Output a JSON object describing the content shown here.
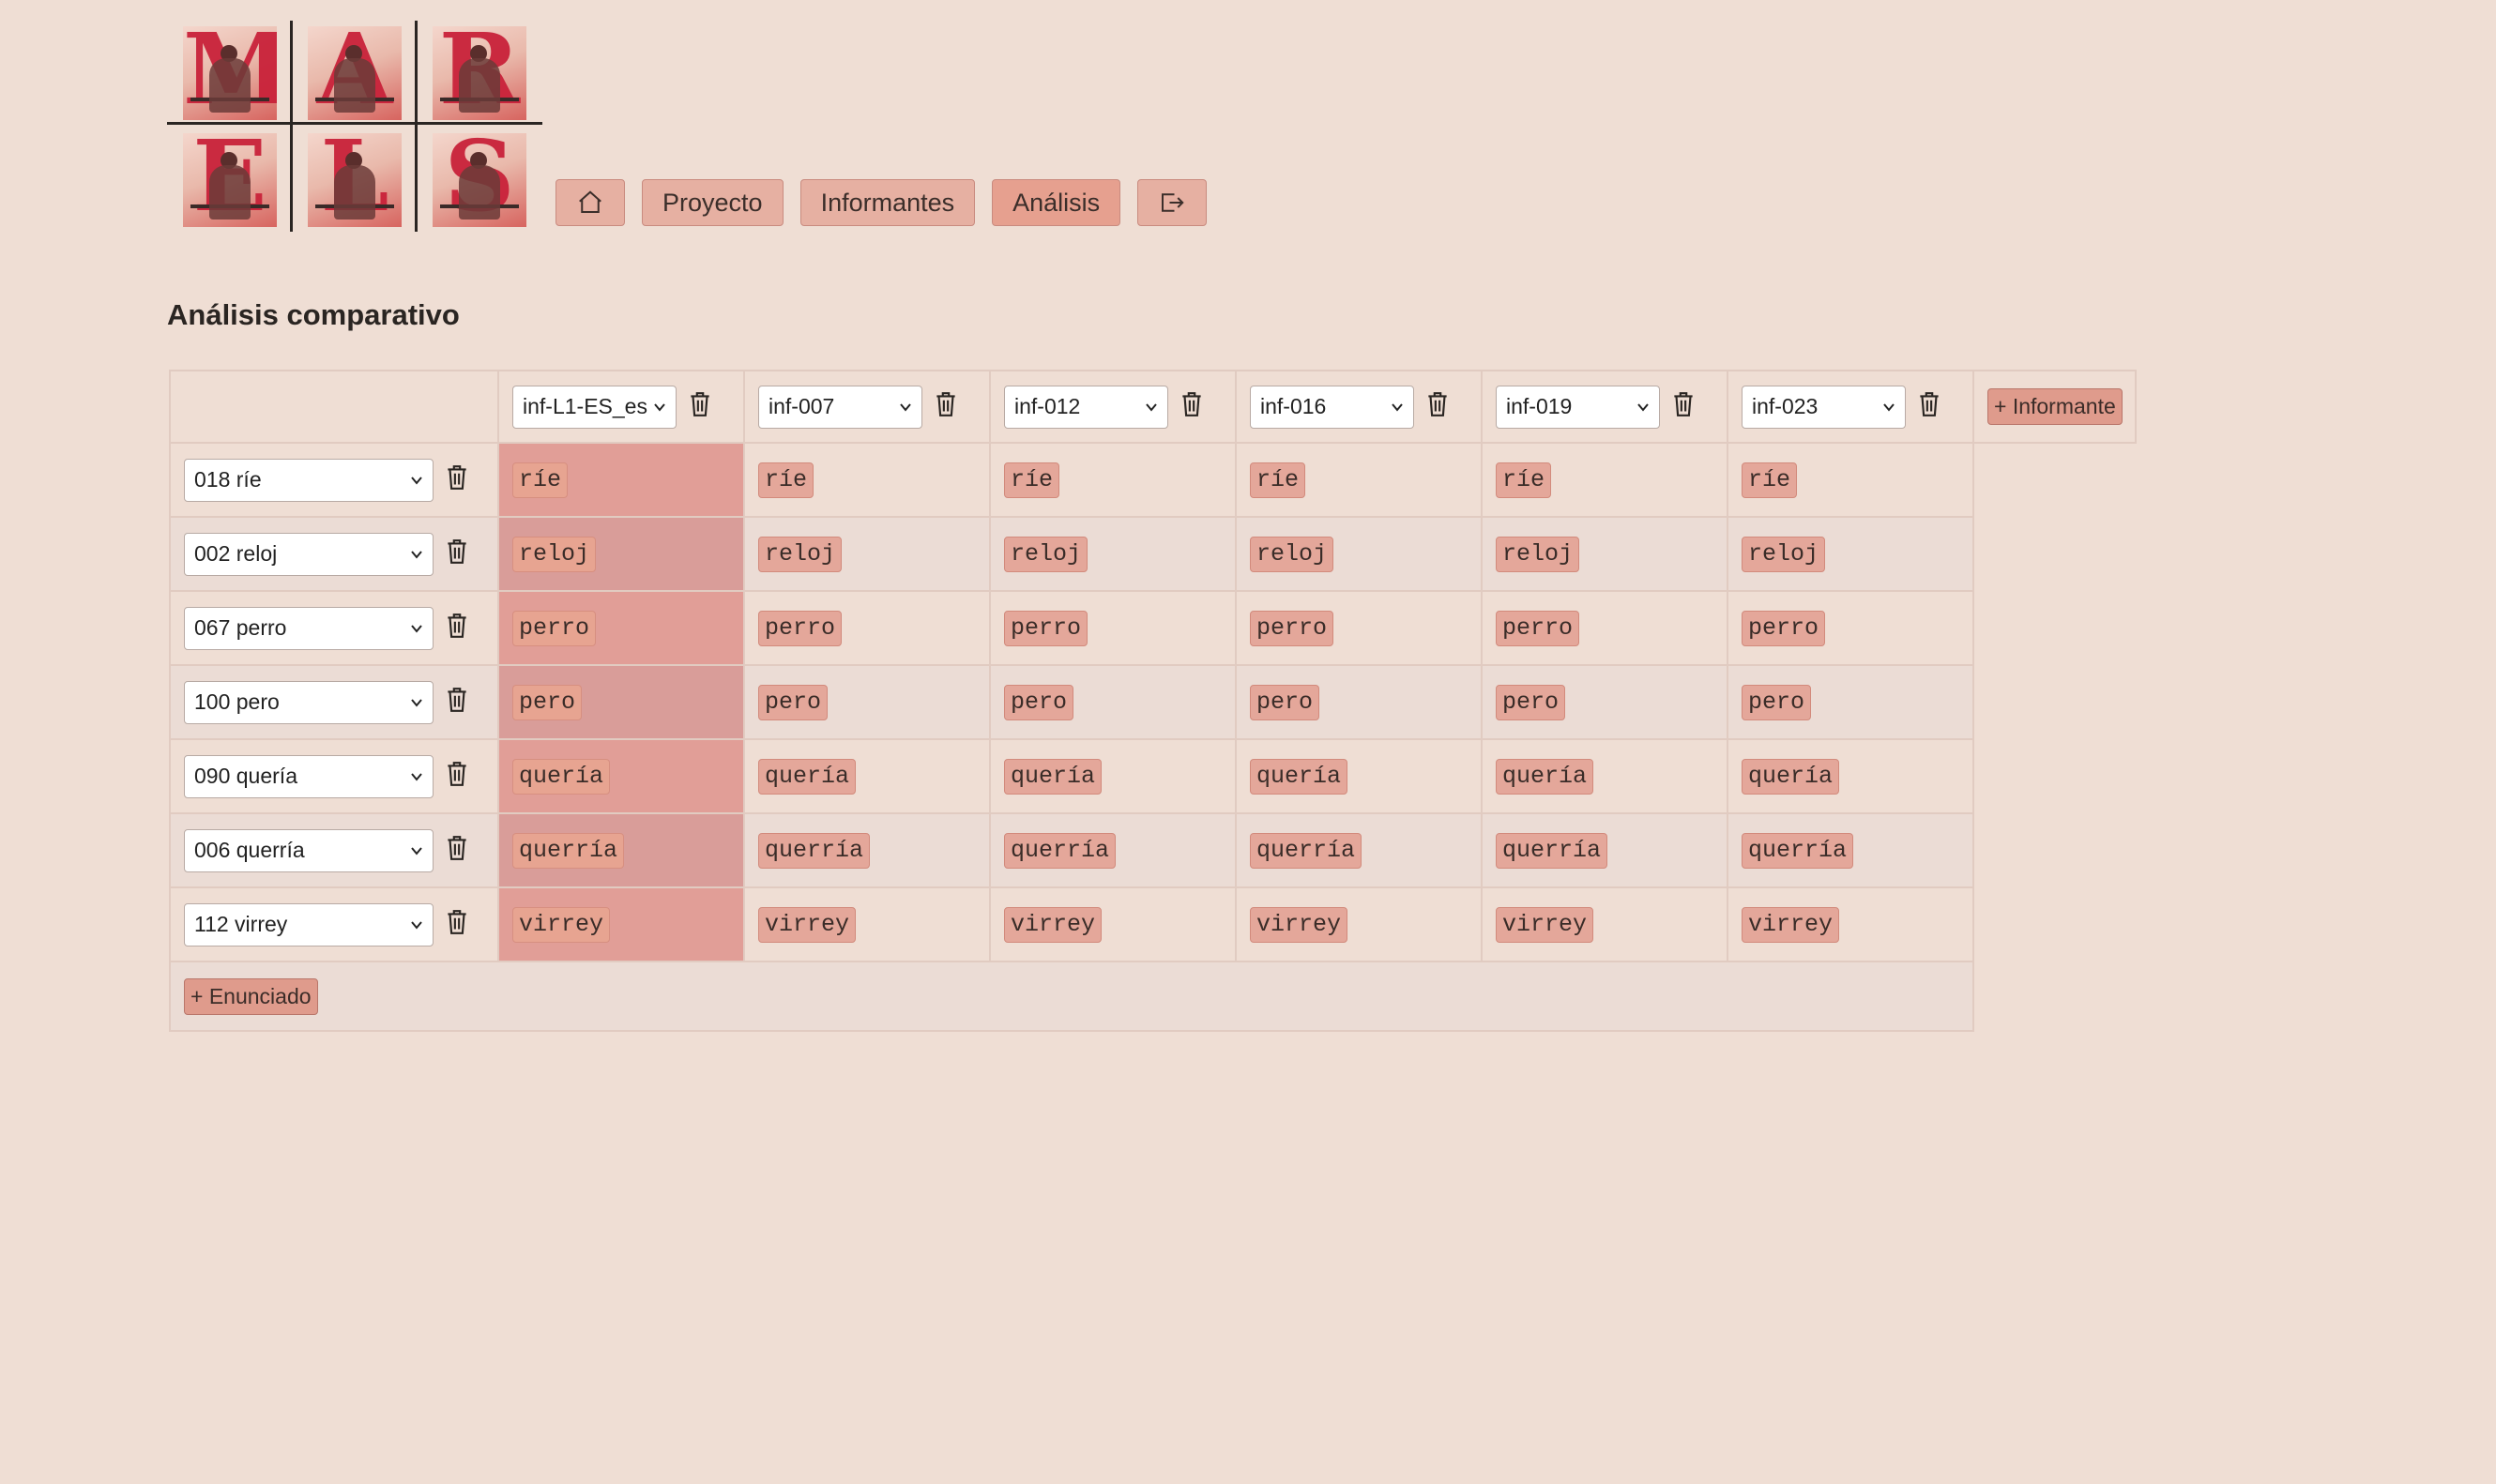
{
  "logo": {
    "letters": [
      "M",
      "A",
      "R",
      "E",
      "L",
      "S"
    ]
  },
  "nav": {
    "home_icon": "home-icon",
    "items": [
      "Proyecto",
      "Informantes",
      "Análisis"
    ],
    "active": "Análisis",
    "logout_icon": "logout-icon"
  },
  "title": "Análisis comparativo",
  "informants": [
    "inf-L1-ES_es",
    "inf-007",
    "inf-012",
    "inf-016",
    "inf-019",
    "inf-023"
  ],
  "add_informant_label": "+ Informante",
  "utterances": [
    {
      "label": "018 ríe",
      "values": [
        "ríe",
        "ríe",
        "ríe",
        "ríe",
        "ríe",
        "ríe"
      ]
    },
    {
      "label": "002 reloj",
      "values": [
        "reloj",
        "reloj",
        "reloj",
        "reloj",
        "reloj",
        "reloj"
      ]
    },
    {
      "label": "067 perro",
      "values": [
        "perro",
        "perro",
        "perro",
        "perro",
        "perro",
        "perro"
      ]
    },
    {
      "label": "100 pero",
      "values": [
        "pero",
        "pero",
        "pero",
        "pero",
        "pero",
        "pero"
      ]
    },
    {
      "label": "090 quería",
      "values": [
        "quería",
        "quería",
        "quería",
        "quería",
        "quería",
        "quería"
      ]
    },
    {
      "label": "006 querría",
      "values": [
        "querría",
        "querría",
        "querría",
        "querría",
        "querría",
        "querría"
      ]
    },
    {
      "label": "112 virrey",
      "values": [
        "virrey",
        "virrey",
        "virrey",
        "virrey",
        "virrey",
        "virrey"
      ]
    }
  ],
  "add_utterance_label": "+ Enunciado",
  "colors": {
    "background": "#efded4",
    "accent": "#e6a08f",
    "reference_column": "#e19e97"
  }
}
